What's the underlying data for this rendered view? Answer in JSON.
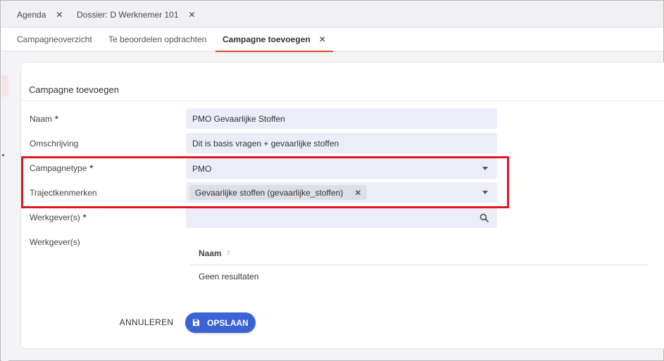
{
  "top_tabs": [
    {
      "label": "Agenda",
      "close": "✕"
    },
    {
      "label": "Dossier: D Werknemer 101",
      "close": "✕"
    }
  ],
  "sub_tabs": [
    {
      "label": "Campagneoverzicht"
    },
    {
      "label": "Te beoordelen opdrachten"
    },
    {
      "label": "Campagne toevoegen",
      "active": true,
      "close": "✕"
    }
  ],
  "form": {
    "title": "Campagne toevoegen",
    "required_marker": "*",
    "naam": {
      "label": "Naam",
      "value": "PMO Gevaarlijke Stoffen"
    },
    "omschrijving": {
      "label": "Omschrijving",
      "value": "Dit is basis vragen + gevaarlijke stoffen"
    },
    "campagnetype": {
      "label": "Campagnetype",
      "value": "PMO"
    },
    "trajectkenmerken": {
      "label": "Trajectkenmerken",
      "chip": "Gevaarlijke stoffen (gevaarlijke_stoffen)",
      "chip_remove": "✕"
    },
    "werkgevers_search": {
      "label": "Werkgever(s)",
      "value": ""
    },
    "werkgevers_table": {
      "label": "Werkgever(s)",
      "column": "Naam",
      "empty_text": "Geen resultaten"
    },
    "cancel_label": "ANNULEREN",
    "save_label": "OPSLAAN"
  },
  "colors": {
    "accent": "#3c63d4",
    "tab_underline": "#d34e2a",
    "highlight_border": "#e0161e",
    "field_bg": "#ecedf8"
  },
  "icons": {
    "tab_close": "close-icon",
    "dropdown": "chevron-down-icon",
    "search": "search-icon",
    "save": "floppy-disk-icon",
    "sort": "sort-icon"
  }
}
